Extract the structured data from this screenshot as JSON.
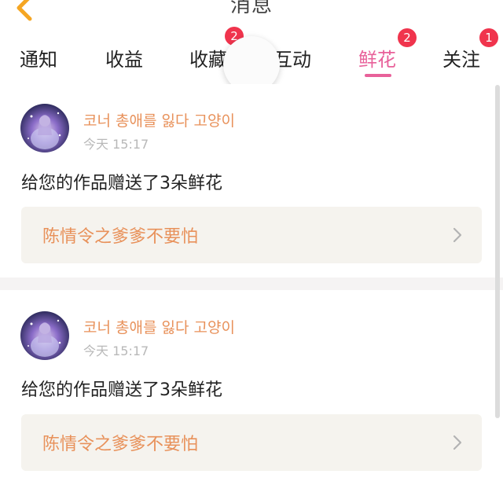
{
  "header": {
    "title": "消息",
    "back_icon": "chevron-left-icon",
    "back_color": "#f5a623"
  },
  "tabs": [
    {
      "label": "通知"
    },
    {
      "label": "收益"
    },
    {
      "label": "收藏",
      "badge": "2"
    },
    {
      "label": "互动"
    },
    {
      "label": "鲜花",
      "badge": "2",
      "active": true
    },
    {
      "label": "关注",
      "badge": "1"
    }
  ],
  "colors": {
    "accent": "#e8619a",
    "username": "#e8915a",
    "badge": "#f0344d",
    "work_box_bg": "#f5f3ee"
  },
  "messages": [
    {
      "username": "코너 총애를 잃다 고양이",
      "time": "今天 15:17",
      "text": "给您的作品赠送了3朵鲜花",
      "work_title": "陈情令之爹爹不要怕"
    },
    {
      "username": "코너 총애를 잃다 고양이",
      "time": "今天 15:17",
      "text": "给您的作品赠送了3朵鲜花",
      "work_title": "陈情令之爹爹不要怕"
    }
  ]
}
